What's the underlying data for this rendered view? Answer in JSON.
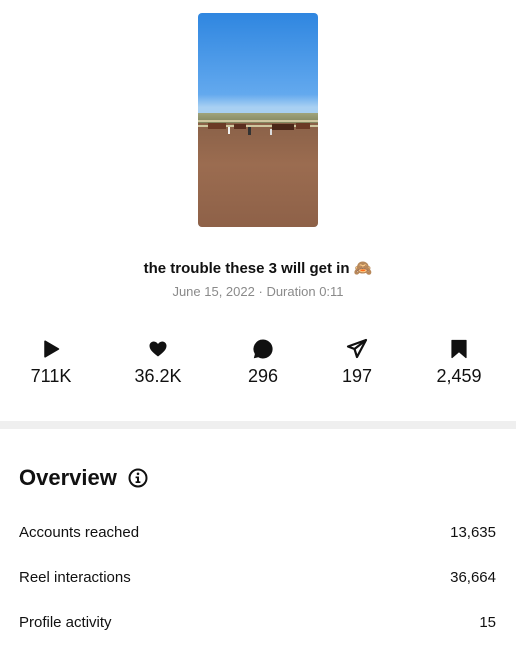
{
  "post": {
    "caption": "the trouble these 3 will get in 🙈",
    "date": "June 15, 2022",
    "separator": "·",
    "duration_label": "Duration",
    "duration": "0:11"
  },
  "stats": [
    {
      "icon": "play-icon",
      "value": "711K"
    },
    {
      "icon": "heart-icon",
      "value": "36.2K"
    },
    {
      "icon": "comment-icon",
      "value": "296"
    },
    {
      "icon": "share-icon",
      "value": "197"
    },
    {
      "icon": "bookmark-icon",
      "value": "2,459"
    }
  ],
  "overview": {
    "title": "Overview",
    "rows": [
      {
        "label": "Accounts reached",
        "value": "13,635"
      },
      {
        "label": "Reel interactions",
        "value": "36,664"
      },
      {
        "label": "Profile activity",
        "value": "15"
      }
    ]
  }
}
